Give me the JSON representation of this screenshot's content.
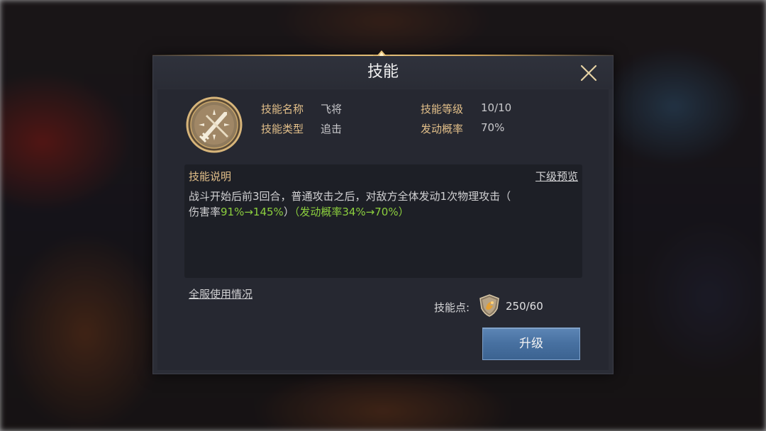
{
  "dialog": {
    "title": "技能",
    "close_icon": "close-icon"
  },
  "skill": {
    "icon": "crossed-swords-icon",
    "name_label": "技能名称",
    "name_value": "飞将",
    "type_label": "技能类型",
    "type_value": "追击",
    "level_label": "技能等级",
    "level_value": "10/10",
    "rate_label": "发动概率",
    "rate_value": "70%"
  },
  "description": {
    "title": "技能说明",
    "next_preview": "下级预览",
    "line1": "战斗开始后前3回合，普通攻击之后，对敌方全体发动1次物理攻击（",
    "line2_prefix": "伤害率",
    "line2_green1": "91%→145%",
    "line2_mid": "）",
    "line2_green2": "（发动概率34%→70%）"
  },
  "footer": {
    "usage_link": "全服使用情况",
    "points_label": "技能点:",
    "points_icon": "skill-point-shield-icon",
    "points_value": "250/60",
    "upgrade_button": "升级"
  },
  "colors": {
    "accent_gold": "#e3c08a",
    "highlight_green": "#8ccf3e",
    "button_blue": "#4770a0"
  }
}
